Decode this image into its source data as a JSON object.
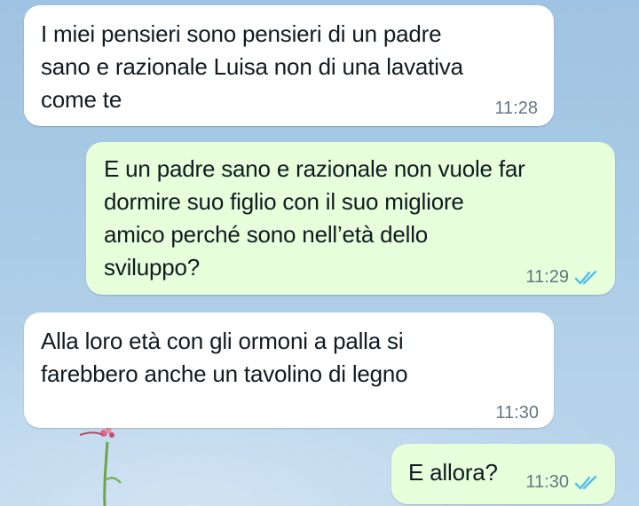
{
  "colors": {
    "incoming_bubble": "#ffffff",
    "outgoing_bubble": "#e7ffdb",
    "read_ticks": "#53bdeb",
    "time_text": "#667781",
    "message_text": "#111b21"
  },
  "messages": [
    {
      "direction": "incoming",
      "text": "I miei pensieri sono pensieri di un padre\nsano e razionale Luisa non di una lavativa\ncome te",
      "time": "11:28"
    },
    {
      "direction": "outgoing",
      "text": "E un padre sano e razionale non vuole far\ndormire suo figlio con il suo migliore\namico perché sono nell’età dello\nsviluppo?",
      "time": "11:29",
      "status_icon": "double-check-read-icon"
    },
    {
      "direction": "incoming",
      "text": "Alla loro età con gli ormoni a palla si\nfarebbero anche un tavolino di legno",
      "time": "11:30"
    },
    {
      "direction": "outgoing",
      "text": "E allora?",
      "time": "11:30",
      "status_icon": "double-check-read-icon"
    }
  ]
}
